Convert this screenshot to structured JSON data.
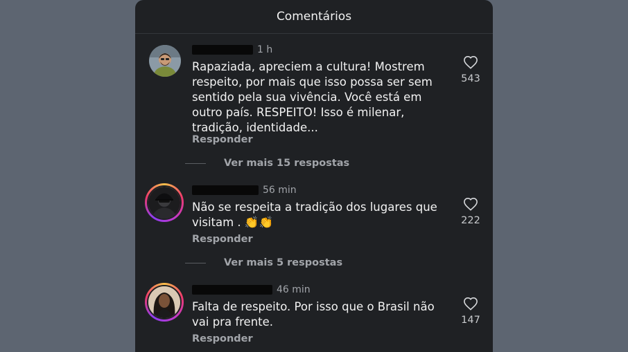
{
  "header": {
    "title": "Comentários"
  },
  "comments": [
    {
      "time": "1 h",
      "text_lines": [
        "Rapaziada, apreciem a cultura! Mostrem",
        "respeito, por mais que isso possa ser sem",
        "sentido pela sua vivência. Você está em",
        "outro país. RESPEITO! Isso é milenar,",
        "tradição, identidade..."
      ],
      "reply_label": "Responder",
      "likes": "543",
      "more_replies": "Ver mais 15 respostas"
    },
    {
      "time": "56 min",
      "text_lines": [
        "Não se respeita a tradição dos lugares que",
        "visitam . 👏👏"
      ],
      "reply_label": "Responder",
      "likes": "222",
      "more_replies": "Ver mais 5 respostas"
    },
    {
      "time": "46 min",
      "text_lines": [
        "Falta de respeito. Por isso que o Brasil não",
        "vai pra frente."
      ],
      "reply_label": "Responder",
      "likes": "147"
    }
  ],
  "colors": {
    "background": "#5d6571",
    "panel": "#1f2124",
    "text": "#f2f2f2",
    "muted": "#a2a5aa"
  }
}
